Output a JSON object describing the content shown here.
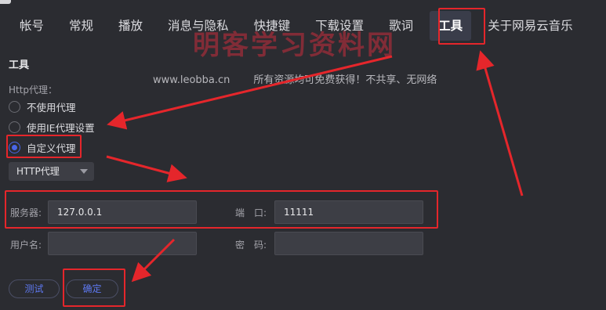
{
  "tabs": [
    {
      "label": "帐号"
    },
    {
      "label": "常规"
    },
    {
      "label": "播放"
    },
    {
      "label": "消息与隐私"
    },
    {
      "label": "快捷键"
    },
    {
      "label": "下载设置"
    },
    {
      "label": "歌词"
    },
    {
      "label": "工具",
      "active": true
    },
    {
      "label": "关于网易云音乐"
    }
  ],
  "watermark": {
    "title": "明客学习资料网",
    "site": "www.leobba.cn",
    "slogan": "所有资源均可免费获得！不共享、无网络"
  },
  "section_title": "工具",
  "proxy": {
    "label": "Http代理：",
    "options": [
      {
        "label": "不使用代理",
        "checked": false
      },
      {
        "label": "使用IE代理设置",
        "checked": false
      },
      {
        "label": "自定义代理",
        "checked": true
      }
    ],
    "type_select": "HTTP代理",
    "server_label": "服务器:",
    "server_value": "127.0.0.1",
    "port_label": "端　口:",
    "port_value": "11111",
    "username_label": "用户名:",
    "username_value": "",
    "password_label": "密　码:",
    "password_value": ""
  },
  "buttons": {
    "test": "测试",
    "confirm": "确定"
  },
  "colors": {
    "background": "#2b2c31",
    "accent": "#4a66e8",
    "annotation_red": "#e5262b"
  }
}
